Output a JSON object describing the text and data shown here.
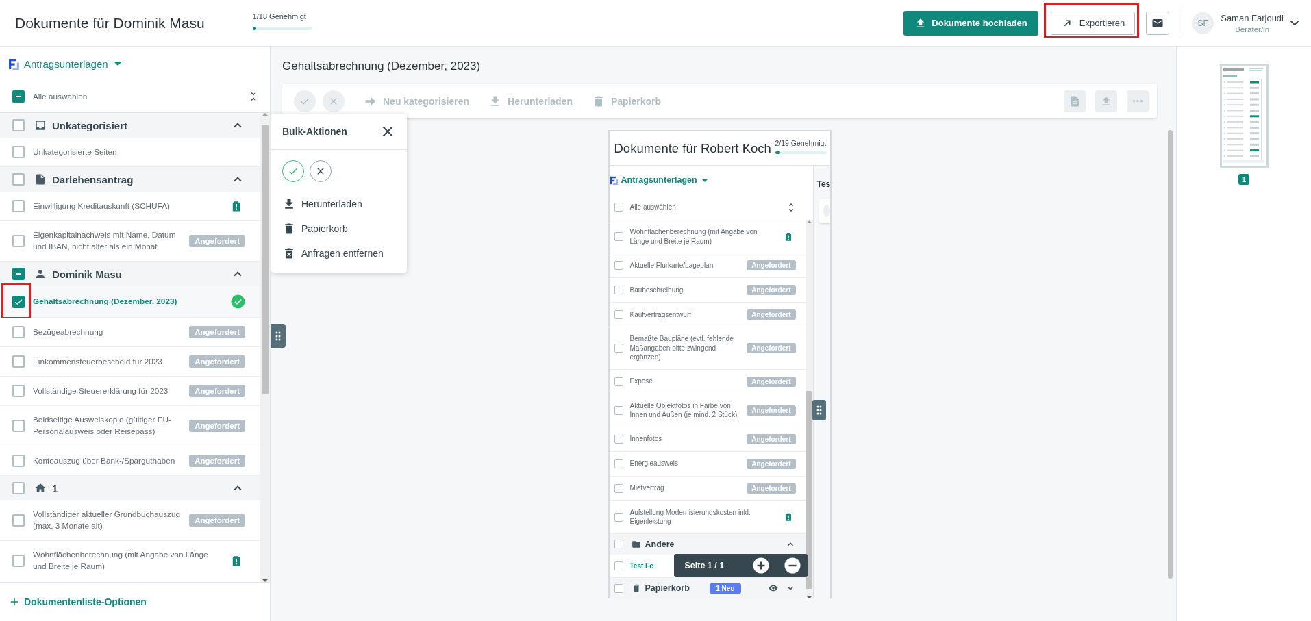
{
  "header": {
    "title": "Dokumente für Dominik Masu",
    "progress": {
      "label": "1/18 Genehmigt",
      "level": 0.056
    },
    "upload_button": "Dokumente hochladen",
    "export": {
      "label": "Exportieren",
      "highlighted": true
    },
    "user": {
      "initials": "SF",
      "name": "Saman Farjoudi",
      "role": "Berater/in"
    }
  },
  "sidebar": {
    "list": {
      "dropdown": "Antragsunterlagen",
      "select_all": {
        "label": "Alle auswählen",
        "checked": true,
        "indeterminate": true
      },
      "groups": [
        {
          "kind": "inbox",
          "title": "Unkategorisiert",
          "checked": false,
          "indeterminate": false,
          "expanded": true,
          "items": [
            {
              "label": "Unkategorisierte Seiten",
              "kind": "none",
              "checked": false,
              "selected": false,
              "has_files": false,
              "highlighted": false
            }
          ]
        },
        {
          "kind": "form",
          "title": "Darlehensantrag",
          "checked": false,
          "indeterminate": false,
          "expanded": true,
          "items": [
            {
              "label": "Einwilligung Kreditauskunft (SCHUFA)",
              "kind": "missing",
              "checked": false,
              "selected": false,
              "has_files": false,
              "highlighted": false
            },
            {
              "label": "Eigenkapitalnachweis mit Name, Datum und IBAN, nicht älter als ein Monat",
              "kind": "requested",
              "badge": "Angefordert",
              "checked": false,
              "selected": false,
              "has_files": false,
              "highlighted": false
            }
          ]
        },
        {
          "kind": "person",
          "title": "Dominik Masu",
          "checked": true,
          "indeterminate": true,
          "expanded": true,
          "items": [
            {
              "label": "Gehaltsabrechnung (Dezember, 2023)",
              "kind": "approved",
              "checked": true,
              "selected": true,
              "has_files": true,
              "highlighted": true
            },
            {
              "label": "Bezügeabrechnung",
              "kind": "requested",
              "badge": "Angefordert",
              "checked": false,
              "selected": false,
              "has_files": false,
              "highlighted": false
            },
            {
              "label": "Einkommensteuerbescheid für 2023",
              "kind": "requested",
              "badge": "Angefordert",
              "checked": false,
              "selected": false,
              "has_files": false,
              "highlighted": false
            },
            {
              "label": "Vollständige Steuererklärung für 2023",
              "kind": "requested",
              "badge": "Angefordert",
              "checked": false,
              "selected": false,
              "has_files": false,
              "highlighted": false
            },
            {
              "label": "Beidseitige Ausweiskopie (gültiger EU-Personalausweis oder Reisepass)",
              "kind": "requested",
              "badge": "Angefordert",
              "checked": false,
              "selected": false,
              "has_files": false,
              "highlighted": false
            },
            {
              "label": "Kontoauszug über Bank-/Sparguthaben",
              "kind": "requested",
              "badge": "Angefordert",
              "checked": false,
              "selected": false,
              "has_files": false,
              "highlighted": false
            }
          ]
        },
        {
          "kind": "property",
          "title": "1",
          "checked": false,
          "indeterminate": false,
          "expanded": true,
          "items": [
            {
              "label": "Vollständiger aktueller Grundbuchauszug (max. 3 Monate alt)",
              "kind": "requested",
              "badge": "Angefordert",
              "checked": false,
              "selected": false,
              "has_files": false,
              "highlighted": false
            },
            {
              "label": "Wohnflächenberechnung (mit Angabe von Länge und Breite je Raum)",
              "kind": "missing",
              "checked": false,
              "selected": false,
              "has_files": false,
              "highlighted": false
            }
          ]
        }
      ]
    },
    "footer": "Dokumentenliste-Optionen"
  },
  "main": {
    "title": "Gehaltsabrechnung (Dezember, 2023)",
    "toolbar": {
      "approve": {
        "disabled": true
      },
      "reject": {
        "disabled": true
      },
      "actions": [
        {
          "kind": "recategorize",
          "label": "Neu kategorisieren",
          "disabled": true
        },
        {
          "kind": "download",
          "label": "Herunterladen",
          "disabled": true
        },
        {
          "kind": "trash",
          "label": "Papierkorb",
          "disabled": true
        }
      ],
      "icon_buttons": [
        {
          "kind": "file",
          "disabled": true
        },
        {
          "kind": "upload",
          "disabled": true
        },
        {
          "kind": "more",
          "disabled": true
        }
      ]
    },
    "bulk_popup": {
      "title": "Bulk-Aktionen",
      "approve": {
        "disabled": false
      },
      "reject": {
        "disabled": false
      },
      "actions": [
        {
          "kind": "download",
          "label": "Herunterladen"
        },
        {
          "kind": "trash",
          "label": "Papierkorb"
        },
        {
          "kind": "remove_requests",
          "label": "Anfragen entfernen"
        }
      ]
    },
    "preview": {
      "title": "Dokumente für Robert Koch",
      "progress": {
        "label": "2/19 Genehmigt",
        "level": 0.105
      },
      "list": {
        "dropdown": "Antragsunterlagen",
        "select_all": {
          "label": "Alle auswählen",
          "checked": false,
          "indeterminate": false
        },
        "groups": [
          {
            "items": [
              {
                "label": "Wohnflächenberechnung (mit Angabe von Länge und Breite je Raum)",
                "kind": "missing",
                "checked": false,
                "has_files": false
              },
              {
                "label": "Aktuelle Flurkarte/Lageplan",
                "kind": "requested",
                "badge": "Angefordert",
                "checked": false,
                "has_files": false
              },
              {
                "label": "Baubeschreibung",
                "kind": "requested",
                "badge": "Angefordert",
                "checked": false,
                "has_files": false
              },
              {
                "label": "Kaufvertragsentwurf",
                "kind": "requested",
                "badge": "Angefordert",
                "checked": false,
                "has_files": false
              },
              {
                "label": "Bemaßte Baupläne (evtl. fehlende Maßangaben bitte zwingend ergänzen)",
                "kind": "requested",
                "badge": "Angefordert",
                "checked": false,
                "has_files": false
              },
              {
                "label": "Exposé",
                "kind": "requested",
                "badge": "Angefordert",
                "checked": false,
                "has_files": false
              },
              {
                "label": "Aktuelle Objektfotos in Farbe von Innen und Außen (je mind. 2 Stück)",
                "kind": "requested",
                "badge": "Angefordert",
                "checked": false,
                "has_files": false
              },
              {
                "label": "Innenfotos",
                "kind": "requested",
                "badge": "Angefordert",
                "checked": false,
                "has_files": false
              },
              {
                "label": "Energieausweis",
                "kind": "requested",
                "badge": "Angefordert",
                "checked": false,
                "has_files": false
              },
              {
                "label": "Mietvertrag",
                "kind": "requested",
                "badge": "Angefordert",
                "checked": false,
                "has_files": false
              },
              {
                "label": "Aufstellung Modernisierungskosten inkl. Eigenleistung",
                "kind": "missing",
                "checked": false,
                "has_files": false
              }
            ]
          },
          {
            "kind": "folder",
            "title": "Andere",
            "checked": false,
            "indeterminate": false,
            "expanded": true,
            "items": [
              {
                "label": "Test Fe",
                "kind": "none",
                "checked": false,
                "has_files": true
              }
            ]
          },
          {
            "kind": "trash",
            "title": "Papierkorb",
            "badge": "1 Neu",
            "checked": false,
            "indeterminate": false,
            "expanded": false
          }
        ]
      },
      "side_title": "Tes",
      "page_controls": {
        "label": "Seite 1 / 1"
      }
    }
  },
  "thumbnails": [
    {
      "page": "1"
    }
  ]
}
